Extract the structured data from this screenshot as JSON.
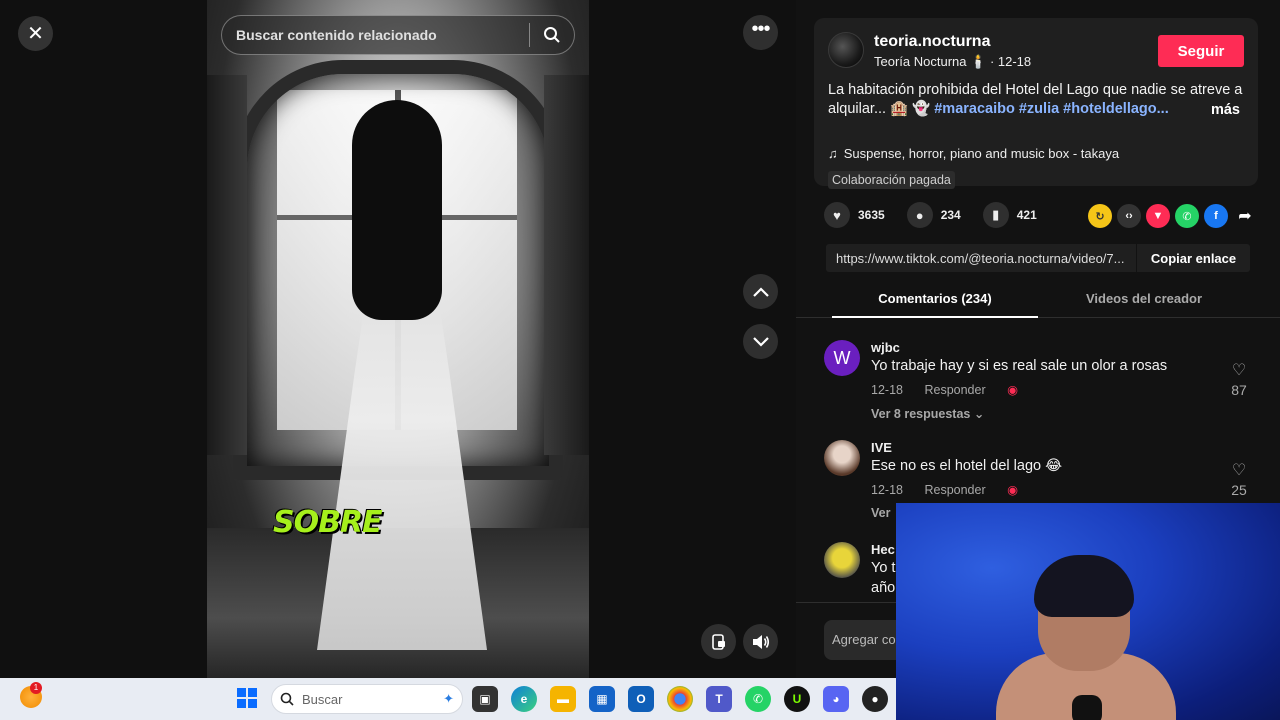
{
  "player": {
    "close_icon": "close-icon",
    "search_placeholder": "Buscar contenido relacionado",
    "more_icon": "more-horizontal-icon",
    "caption_word": "SOBRE",
    "nav_up_icon": "chevron-up-icon",
    "nav_down_icon": "chevron-down-icon",
    "mini_player_icon": "picture-in-picture-icon",
    "volume_icon": "volume-icon"
  },
  "creator": {
    "username": "teoria.nocturna",
    "display_name": "Teoría Nocturna",
    "emoji": "🕯️",
    "date": "· 12-18",
    "follow_label": "Seguir"
  },
  "description": {
    "text": "La habitación prohibida del Hotel del Lago que nadie se atreve a alquilar... 🏨 👻 ",
    "hashtags": "#maracaibo #zulia #hoteldellago...",
    "more_label": "más",
    "music": "Suspense, horror, piano and music box - takaya",
    "paid_label": "Colaboración pagada"
  },
  "stats": {
    "likes": "3635",
    "comments": "234",
    "saves": "421"
  },
  "share": {
    "link": "https://www.tiktok.com/@teoria.nocturna/video/7...",
    "copy_label": "Copiar enlace"
  },
  "tabs": {
    "comments_label": "Comentarios (234)",
    "videos_label": "Videos del creador"
  },
  "comments": [
    {
      "avatar_letter": "W",
      "avatar_color": "#6a1fbf",
      "user": "wjbc",
      "text": "Yo trabaje hay y si es real sale un olor a rosas",
      "date": "12-18",
      "reply_label": "Responder",
      "likes": "87",
      "replies_label": "Ver 8 respuestas ⌄"
    },
    {
      "avatar_letter": "",
      "avatar_color": "#c9b8a8",
      "user": "IVE",
      "text": "Ese no es el hotel del lago 😂",
      "date": "12-18",
      "reply_label": "Responder",
      "likes": "25",
      "replies_label": "Ver"
    },
    {
      "avatar_letter": "",
      "avatar_color": "#d4c21f",
      "user": "Hec",
      "text": "Yo t",
      "text2": "año"
    }
  ],
  "add_comment_placeholder": "Agregar co",
  "taskbar": {
    "weather_badge": "1",
    "search_label": "Buscar"
  }
}
